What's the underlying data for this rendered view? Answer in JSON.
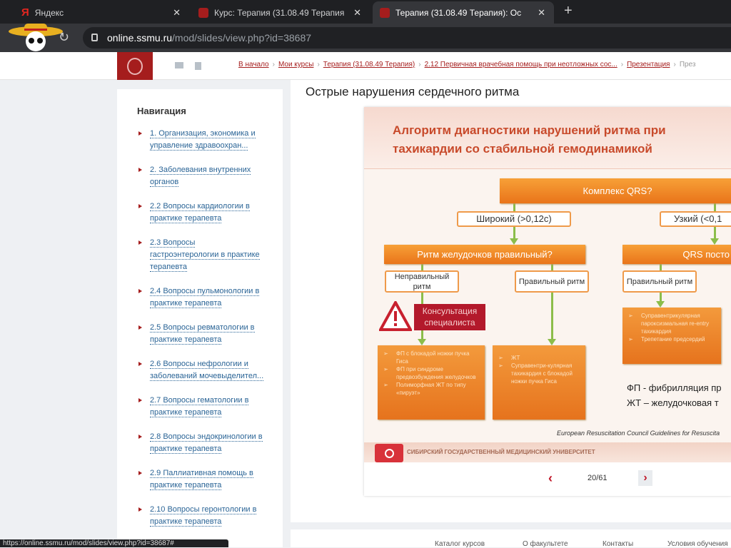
{
  "browser": {
    "tabs": [
      {
        "title": "Яндекс"
      },
      {
        "title": "Курс: Терапия (31.08.49 Терапия"
      },
      {
        "title": "Терапия (31.08.49 Терапия): Ос"
      }
    ],
    "url_host": "online.ssmu.ru",
    "url_path": "/mod/slides/view.php?id=38687",
    "status_url": "https://online.ssmu.ru/mod/slides/view.php?id=38687#"
  },
  "breadcrumbs": [
    "В начало",
    "Мои курсы",
    "Терапия (31.08.49 Терапия)",
    "2.12 Первичная врачебная помощь при неотложных сос...",
    "Презентация",
    "През"
  ],
  "sidebar": {
    "title": "Навигация",
    "items": [
      "1. Организация, экономика и управление здравоохран...",
      "2. Заболевания внутренних органов",
      "2.2 Вопросы кардиологии в практике терапевта",
      "2.3 Вопросы гастроэнтерологии в практике терапевта",
      "2.4 Вопросы пульмонологии в практике терапевта",
      "2.5 Вопросы ревматологии в практике терапевта",
      "2.6 Вопросы нефрологии и заболеваний мочевыделител...",
      "2.7 Вопросы гематологии в практике терапевта",
      "2.8 Вопросы эндокринологии в практике терапевта",
      "2.9 Паллиативная помощь в практике терапевта",
      "2.10 Вопросы геронтологии в практике терапевта"
    ]
  },
  "page_title": "Острые нарушения сердечного ритма",
  "slide": {
    "title_line1": "Алгоритм диагностики нарушений ритма при",
    "title_line2": "тахикардии со стабильной гемодинамикой",
    "qrs": "Комплекс QRS?",
    "wide": "Широкий (>0,12с)",
    "narrow": "Узкий  (<0,1",
    "ventricular": "Ритм желудочков правильный?",
    "qrs_const": "QRS посто",
    "irregular": "Неправильный ритм",
    "regular": "Правильный ритм",
    "regular2": "Правильный ритм",
    "consult": "Консультация специалиста",
    "left_list": [
      "ФП с блокадой ножки пучка Гиса",
      "ФП при синдроме предвозбуждения желудочков",
      "Полиморфная ЖТ по типу «пируэт»"
    ],
    "mid_list": [
      "ЖТ",
      "Суправентри-кулярная тахикардия с блокадой ножки пучка Гиса"
    ],
    "right_list": [
      "Суправентрикулярная пароксизмальная re-entry тахикардия",
      "Трепетание предсердий"
    ],
    "legend1": "ФП - фибрилляция пр",
    "legend2": "ЖТ – желудочковая т",
    "source": "European Resuscitation Council Guidelines for Resuscita",
    "university": "СИБИРСКИЙ ГОСУДАРСТВЕННЫЙ МЕДИЦИНСКИЙ УНИВЕРСИТЕТ"
  },
  "pager": {
    "prev": "‹",
    "next": "›",
    "count": "20/61"
  },
  "footer": [
    "Каталог курсов",
    "О факультете",
    "Контакты",
    "Условия обучения"
  ]
}
